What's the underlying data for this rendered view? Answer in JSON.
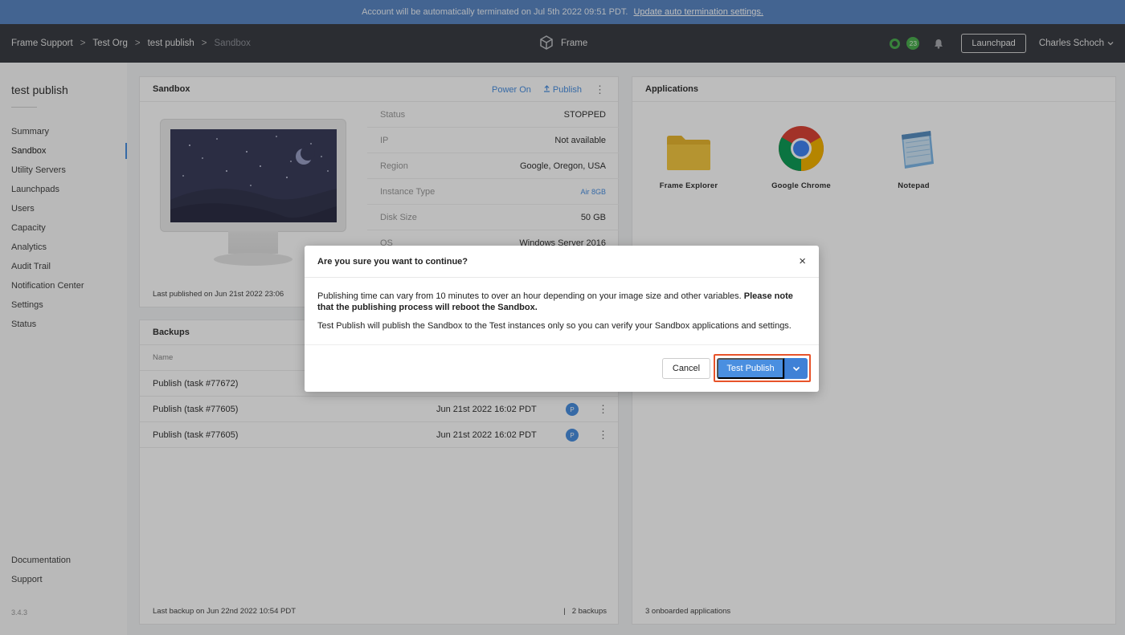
{
  "banner": {
    "message": "Account will be automatically terminated on Jul 5th 2022 09:51 PDT.",
    "link": "Update auto termination settings."
  },
  "topbar": {
    "breadcrumbs": [
      "Frame Support",
      "Test Org",
      "test publish",
      "Sandbox"
    ],
    "separator": ">",
    "brand": "Frame",
    "status_count": "23",
    "launchpad_label": "Launchpad",
    "user_name": "Charles Schoch"
  },
  "sidebar": {
    "title": "test publish",
    "items": [
      {
        "label": "Summary"
      },
      {
        "label": "Sandbox"
      },
      {
        "label": "Utility Servers"
      },
      {
        "label": "Launchpads"
      },
      {
        "label": "Users"
      },
      {
        "label": "Capacity"
      },
      {
        "label": "Analytics"
      },
      {
        "label": "Audit Trail"
      },
      {
        "label": "Notification Center"
      },
      {
        "label": "Settings"
      },
      {
        "label": "Status"
      }
    ],
    "active_item": "Sandbox",
    "bottom": [
      "Documentation",
      "Support"
    ],
    "version": "3.4.3"
  },
  "sandbox": {
    "title": "Sandbox",
    "power_on": "Power On",
    "publish": "Publish",
    "details": [
      {
        "key": "Status",
        "value": "STOPPED"
      },
      {
        "key": "IP",
        "value": "Not available"
      },
      {
        "key": "Region",
        "value": "Google, Oregon, USA"
      },
      {
        "key": "Instance Type",
        "value": "Air 8GB"
      },
      {
        "key": "Disk Size",
        "value": "50 GB"
      },
      {
        "key": "OS",
        "value": "Windows Server 2016"
      }
    ],
    "last_published": "Last published on Jun 21st 2022 23:06"
  },
  "backups": {
    "title": "Backups",
    "col_name": "Name",
    "rows": [
      {
        "name": "Publish (task #77672)",
        "date": "",
        "badge": ""
      },
      {
        "name": "Publish (task #77605)",
        "date": "Jun 21st 2022 16:02 PDT",
        "badge": "P"
      },
      {
        "name": "Publish (task #77605)",
        "date": "Jun 21st 2022 16:02 PDT",
        "badge": "P"
      }
    ],
    "footer_left": "Last backup on Jun 22nd 2022 10:54 PDT",
    "footer_divider": "|",
    "footer_right": "2 backups"
  },
  "applications": {
    "title": "Applications",
    "apps": [
      {
        "label": "Frame Explorer",
        "icon": "folder-icon"
      },
      {
        "label": "Google Chrome",
        "icon": "chrome-icon"
      },
      {
        "label": "Notepad",
        "icon": "notepad-icon"
      }
    ],
    "footer": "3 onboarded applications"
  },
  "modal": {
    "title": "Are you sure you want to continue?",
    "close": "×",
    "body_1": "Publishing time can vary from 10 minutes to over an hour depending on your image size and other variables.",
    "body_1_bold": "Please note that the publishing process will reboot the Sandbox.",
    "body_2": "Test Publish will publish the Sandbox to the Test instances only so you can verify your Sandbox applications and settings.",
    "cancel": "Cancel",
    "confirm": "Test Publish"
  },
  "colors": {
    "banner": "#5b87c4",
    "topbar": "#3a3d44",
    "accent": "#4a8fe0",
    "status_green": "#4caf50",
    "highlight": "#e8532a"
  }
}
